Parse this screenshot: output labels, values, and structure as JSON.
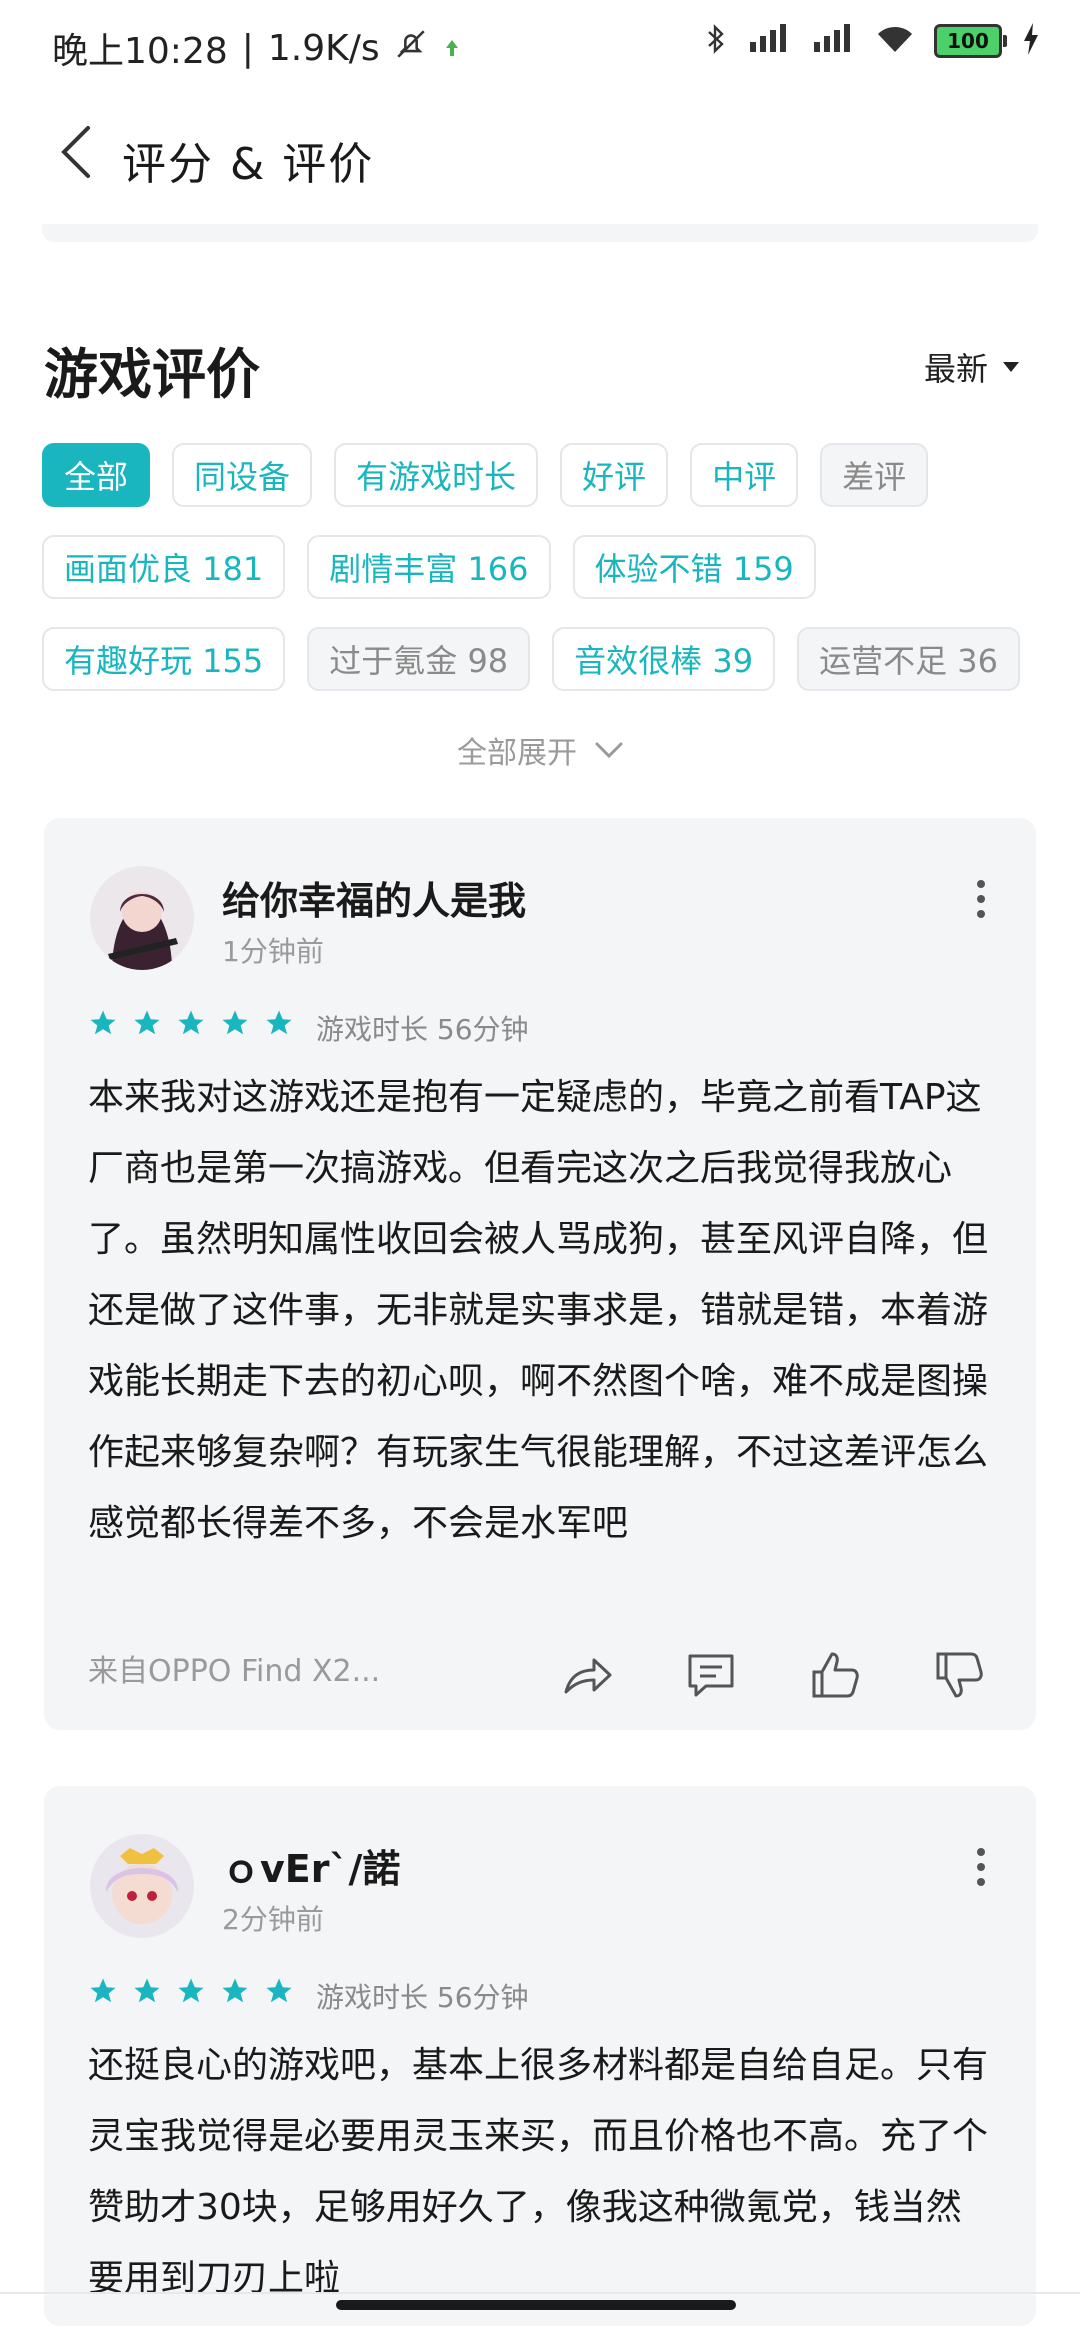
{
  "status_bar": {
    "time": "晚上10:28",
    "speed": "1.9K/s",
    "battery": "100"
  },
  "header": {
    "title": "评分 & 评价"
  },
  "section": {
    "title": "游戏评价",
    "sort_label": "最新"
  },
  "tags": {
    "row1": [
      "全部",
      "同设备",
      "有游戏时长",
      "好评",
      "中评",
      "差评"
    ],
    "row2": [
      "画面优良 181",
      "剧情丰富 166",
      "体验不错 159"
    ],
    "row3": [
      "有趣好玩 155",
      "过于氪金 98",
      "音效很棒 39",
      "运营不足 36"
    ]
  },
  "expand_label": "全部展开",
  "reviews": [
    {
      "username": "给你幸福的人是我",
      "time": "1分钟前",
      "playtime": "游戏时长 56分钟",
      "rating": 5,
      "body": "本来我对这游戏还是抱有一定疑虑的，毕竟之前看TAP这厂商也是第一次搞游戏。但看完这次之后我觉得我放心了。虽然明知属性收回会被人骂成狗，甚至风评自降，但还是做了这件事，无非就是实事求是，错就是错，本着游戏能长期走下去的初心呗，啊不然图个啥，难不成是图操作起来够复杂啊？有玩家生气很能理解，不过这差评怎么感觉都长得差不多，不会是水军吧",
      "device": "来自OPPO Find X2..."
    },
    {
      "username": "ｏvEr`/諾",
      "time": "2分钟前",
      "playtime": "游戏时长 56分钟",
      "rating": 5,
      "body": "还挺良心的游戏吧，基本上很多材料都是自给自足。只有灵宝我觉得是必要用灵玉来买，而且价格也不高。充了个赞助才30块，足够用好久了，像我这种微氪党，钱当然要用到刀刃上啦"
    }
  ],
  "colors": {
    "accent": "#19b6c0",
    "card_bg": "#f4f5f7",
    "star": "#19b6c0"
  }
}
